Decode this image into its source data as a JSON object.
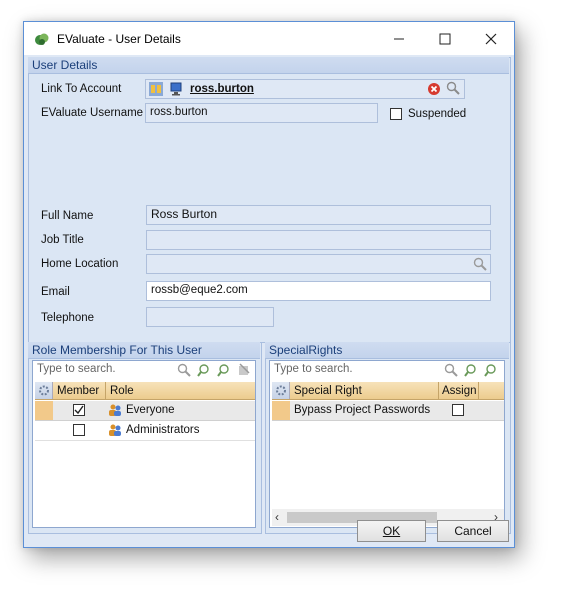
{
  "window": {
    "title": "EValuate - User Details"
  },
  "user_details": {
    "group_title": "User Details",
    "link_label": "Link To Account",
    "link_value": "ross.burton",
    "username_label": "EValuate Username",
    "username_value": "ross.burton",
    "suspended_label": "Suspended",
    "suspended_checked": false,
    "fullname_label": "Full Name",
    "fullname_value": "Ross Burton",
    "jobtitle_label": "Job Title",
    "jobtitle_value": "",
    "home_label": "Home Location",
    "home_value": "",
    "email_label": "Email",
    "email_value": "rossb@eque2.com",
    "telephone_label": "Telephone",
    "telephone_value": ""
  },
  "roles": {
    "group_title": "Role Membership For This User",
    "search_placeholder": "Type to search.",
    "columns": {
      "member": "Member",
      "role": "Role"
    },
    "rows": [
      {
        "role": "Everyone",
        "member": true
      },
      {
        "role": "Administrators",
        "member": false
      }
    ]
  },
  "special_rights": {
    "group_title": "SpecialRights",
    "search_placeholder": "Type to search.",
    "columns": {
      "right": "Special Right",
      "assign": "Assign"
    },
    "rows": [
      {
        "right": "Bypass Project Passwords",
        "assign": false
      }
    ]
  },
  "buttons": {
    "ok": "OK",
    "cancel": "Cancel"
  },
  "colors": {
    "accent": "#5b8fd6",
    "header_orange": "#eccc8e",
    "form_bg": "#dfe8f5"
  }
}
